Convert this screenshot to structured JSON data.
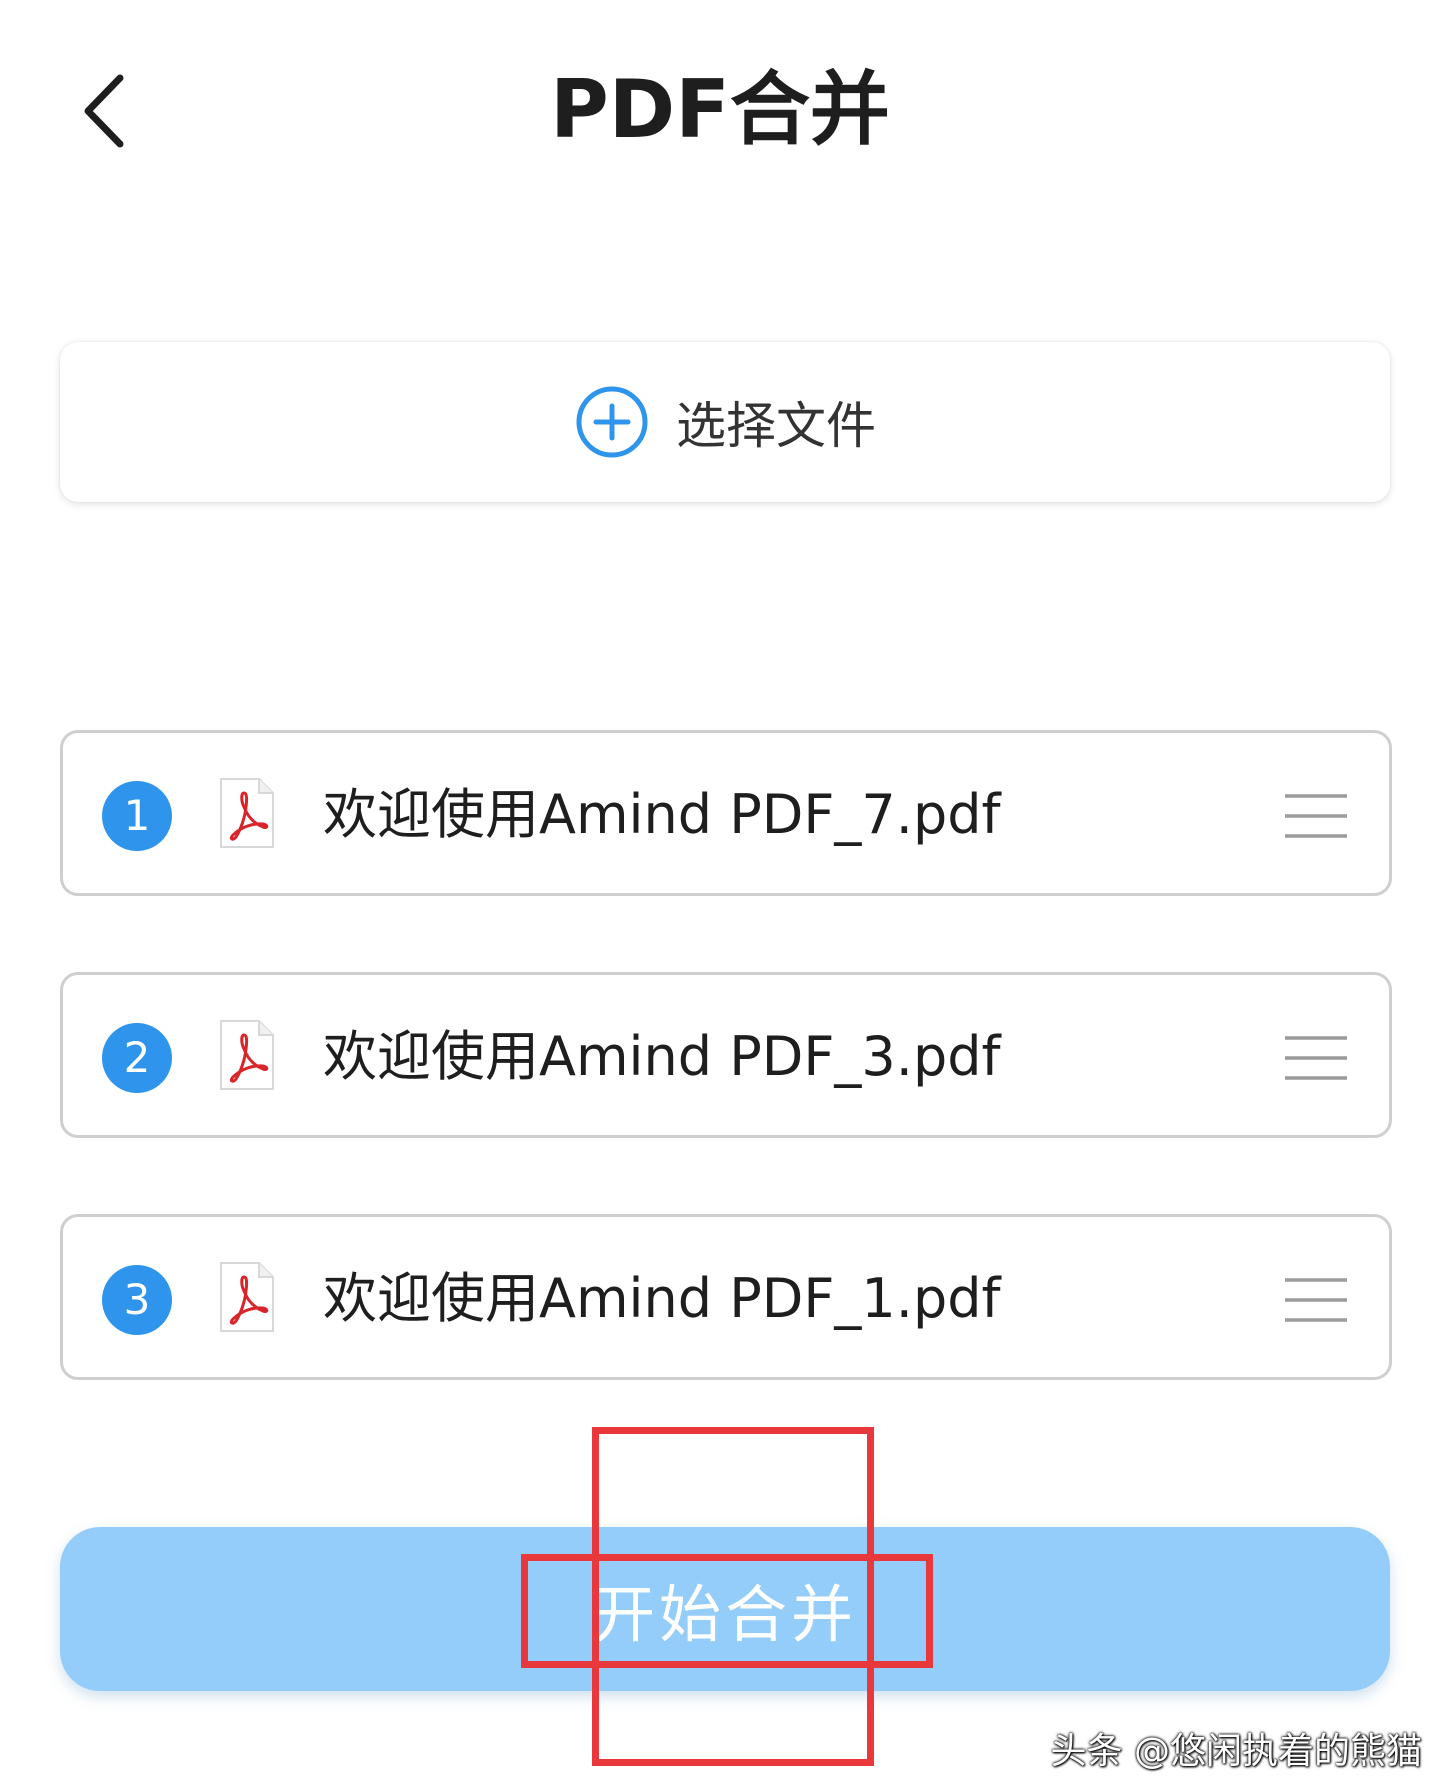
{
  "header": {
    "title": "PDF合并",
    "back_icon": "chevron-left-icon"
  },
  "select_files": {
    "label": "选择文件",
    "icon": "plus-circle-icon",
    "accent_color": "#2f95ec"
  },
  "files": [
    {
      "index": "1",
      "name": "欢迎使用Amind PDF_7.pdf"
    },
    {
      "index": "2",
      "name": "欢迎使用Amind PDF_3.pdf"
    },
    {
      "index": "3",
      "name": "欢迎使用Amind PDF_1.pdf"
    }
  ],
  "file_icon": "pdf-file-icon",
  "drag_icon": "drag-handle-icon",
  "merge_button": {
    "label": "开始合并",
    "background_color": "#94ccfa"
  },
  "annotation_color": "#e8383b",
  "watermark": "头条 @悠闲执着的熊猫"
}
